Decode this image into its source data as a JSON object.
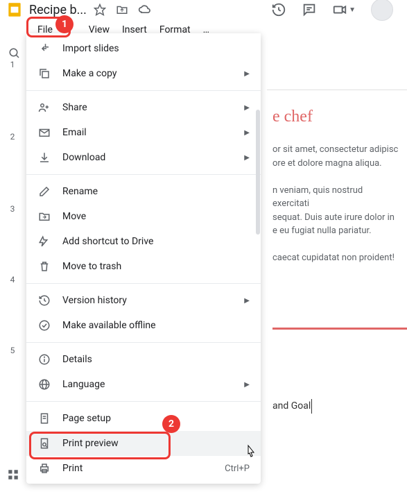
{
  "header": {
    "title": "Recipe b..."
  },
  "menubar": {
    "file": "File",
    "view": "View",
    "insert": "Insert",
    "format": "Format",
    "more": "…"
  },
  "dropdown": {
    "import_slides": "Import slides",
    "make_copy": "Make a copy",
    "share": "Share",
    "email": "Email",
    "download": "Download",
    "rename": "Rename",
    "move": "Move",
    "add_shortcut": "Add shortcut to Drive",
    "move_trash": "Move to trash",
    "version_history": "Version history",
    "make_offline": "Make available offline",
    "details": "Details",
    "language": "Language",
    "page_setup": "Page setup",
    "print_preview": "Print preview",
    "print": "Print",
    "print_shortcut": "Ctrl+P"
  },
  "slides": {
    "numbers": [
      "1",
      "2",
      "3",
      "4",
      "5"
    ]
  },
  "content": {
    "title": "e chef",
    "para1a": "or sit amet, consectetur adipisc",
    "para1b": "ore et dolore magna aliqua.",
    "para2a": "n veniam, quis nostrud exercitati",
    "para2b": "sequat. Duis aute irure dolor in",
    "para2c": "e eu fugiat nulla pariatur.",
    "para3": "caecat cupidatat non proident!",
    "caption": "and Goal"
  },
  "annotations": {
    "badge1": "1",
    "badge2": "2"
  }
}
